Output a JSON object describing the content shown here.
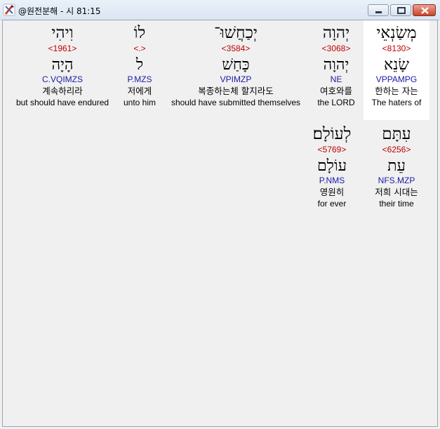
{
  "window": {
    "title": "@원전분해 - 시 81:15",
    "app_icon": "tools-icon",
    "controls": [
      "minimize",
      "maximize",
      "close"
    ]
  },
  "rows": [
    {
      "words": [
        {
          "hebrew": "מְשַׂנְאֵי",
          "strong": "<8130>",
          "lemma": "שָׂנֵא",
          "morph": "VPPAMPG",
          "korean": "한하는 자는",
          "english": "The haters of",
          "highlighted": true
        },
        {
          "hebrew": "יְהוָה",
          "strong": "<3068>",
          "lemma": "יְהוָה",
          "morph": "NE",
          "korean": "여호와를",
          "english": "the LORD",
          "highlighted": false
        },
        {
          "hebrew": "יְכַחֲשׁוּ־",
          "strong": "<3584>",
          "lemma": "כָּחַשׁ",
          "morph": "VPIMZP",
          "korean": "복종하는체 할지라도",
          "english": "should have submitted themselves",
          "highlighted": false
        },
        {
          "hebrew": "לוֹ",
          "strong": "<.>",
          "lemma": "ל",
          "morph": "P.MZS",
          "korean": "저에게",
          "english": "unto him",
          "highlighted": false
        },
        {
          "hebrew": "וִיהִי",
          "strong": "<1961>",
          "lemma": "הָיָה",
          "morph": "C.VQIMZS",
          "korean": "계속하리라",
          "english": "but should have endured",
          "highlighted": false
        }
      ]
    },
    {
      "words": [
        {
          "hebrew": "עִתָּם",
          "strong": "<6256>",
          "lemma": "עֵת",
          "morph": "NFS.MZP",
          "korean": "저희 시대는",
          "english": "their time",
          "highlighted": false
        },
        {
          "hebrew": "לְעוֹלָם׃",
          "strong": "<5769>",
          "lemma": "עוֹלָם",
          "morph": "P.NMS",
          "korean": "영원히",
          "english": "for ever",
          "highlighted": false
        }
      ]
    }
  ]
}
